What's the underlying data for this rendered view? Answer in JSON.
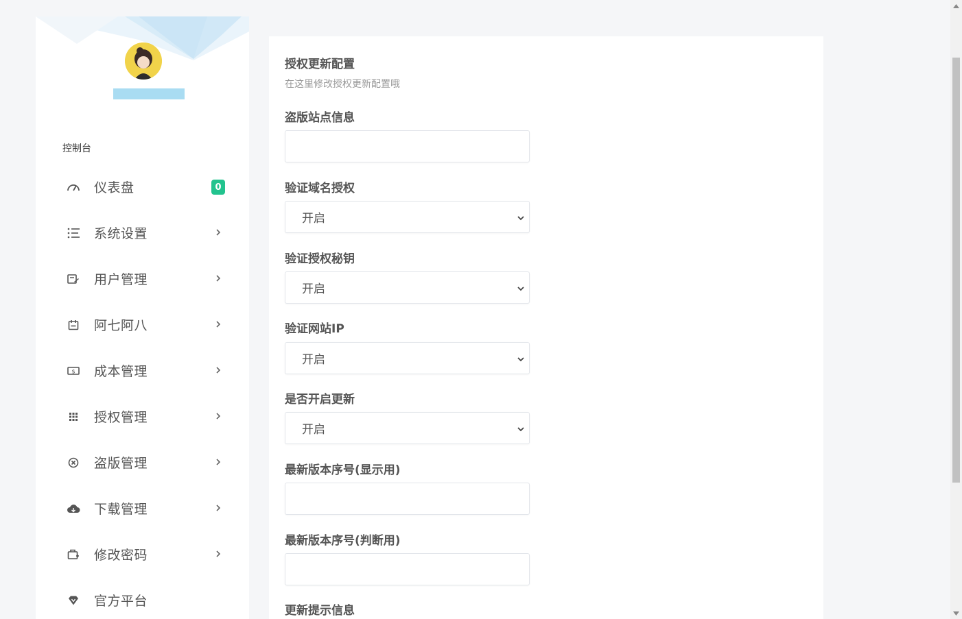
{
  "sidebar": {
    "section_title": "控制台",
    "items": [
      {
        "label": "仪表盘",
        "icon": "dashboard-gauge-icon",
        "badge": "0"
      },
      {
        "label": "系统设置",
        "icon": "list-icon"
      },
      {
        "label": "用户管理",
        "icon": "user-card-icon"
      },
      {
        "label": "阿七阿八",
        "icon": "calendar-icon"
      },
      {
        "label": "成本管理",
        "icon": "money-icon"
      },
      {
        "label": "授权管理",
        "icon": "grid-dots-icon"
      },
      {
        "label": "盗版管理",
        "icon": "circle-x-icon"
      },
      {
        "label": "下载管理",
        "icon": "cloud-download-icon"
      },
      {
        "label": "修改密码",
        "icon": "briefcase-icon"
      },
      {
        "label": "官方平台",
        "icon": "diamond-heart-icon"
      }
    ]
  },
  "main": {
    "title": "授权更新配置",
    "subtitle": "在这里修改授权更新配置哦",
    "fields": [
      {
        "label": "盗版站点信息",
        "type": "input",
        "value": ""
      },
      {
        "label": "验证域名授权",
        "type": "select",
        "value": "开启"
      },
      {
        "label": "验证授权秘钥",
        "type": "select",
        "value": "开启"
      },
      {
        "label": "验证网站IP",
        "type": "select",
        "value": "开启"
      },
      {
        "label": "是否开启更新",
        "type": "select",
        "value": "开启"
      },
      {
        "label": "最新版本序号(显示用)",
        "type": "input",
        "value": ""
      },
      {
        "label": "最新版本序号(判断用)",
        "type": "input",
        "value": ""
      },
      {
        "label": "更新提示信息",
        "type": "label_only"
      }
    ]
  },
  "colors": {
    "badge": "#22c38e",
    "sidebar_bg": "#ffffff",
    "page_bg": "#f5f6f8",
    "accent_banner": "#a9dcf2"
  }
}
